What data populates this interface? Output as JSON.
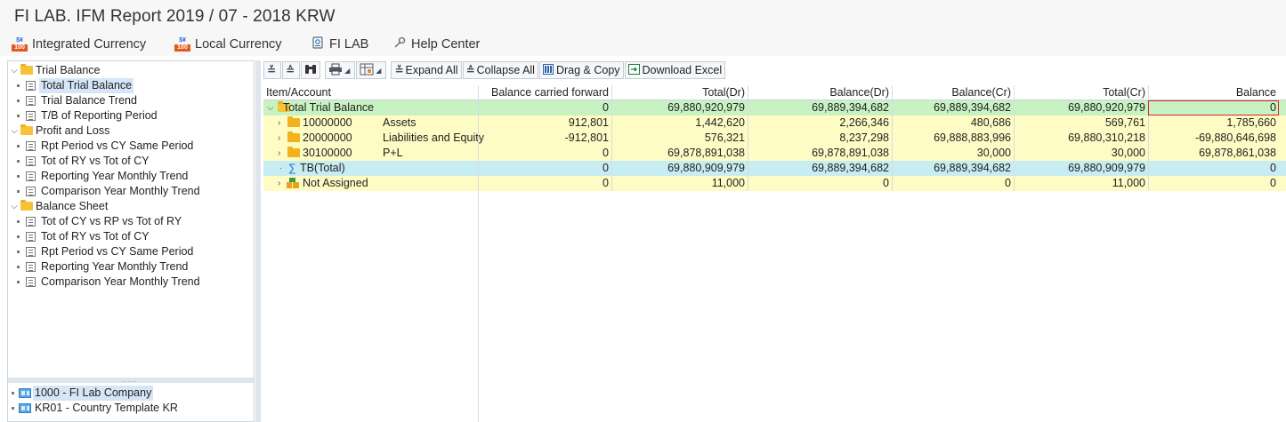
{
  "window": {
    "title": "FI LAB. IFM Report 2019 / 07 - 2018 KRW"
  },
  "menu": [
    {
      "label": "Integrated Currency",
      "icon": "currency-icon"
    },
    {
      "label": "Local Currency",
      "icon": "currency-icon"
    },
    {
      "label": "FI LAB",
      "icon": "fi-lab-icon"
    },
    {
      "label": "Help Center",
      "icon": "help-icon"
    }
  ],
  "nav_tree": {
    "groups": [
      {
        "label": "Trial Balance",
        "expanded": true,
        "items": [
          "Total Trial Balance",
          "Trial Balance Trend",
          "T/B of Reporting Period"
        ]
      },
      {
        "label": "Profit and Loss",
        "expanded": true,
        "items": [
          "Rpt Period vs CY Same Period",
          "Tot of RY vs Tot of CY",
          "Reporting Year Monthly Trend",
          "Comparison Year Monthly Trend"
        ]
      },
      {
        "label": "Balance Sheet",
        "expanded": true,
        "items": [
          "Tot of CY vs RP vs Tot of RY",
          "Tot of RY vs Tot of CY",
          "Rpt Period vs CY Same Period",
          "Reporting Year Monthly Trend",
          "Comparison Year Monthly Trend"
        ]
      }
    ],
    "selected": "Total Trial Balance"
  },
  "companies": [
    {
      "label": "1000 - FI Lab Company",
      "selected": true
    },
    {
      "label": "KR01 - Country Template KR",
      "selected": false
    }
  ],
  "toolbar": {
    "expand_all": "Expand All",
    "collapse_all": "Collapse All",
    "drag_copy": "Drag & Copy",
    "download_excel": "Download Excel"
  },
  "table": {
    "columns": [
      "Item/Account",
      "Balance carried forward",
      "Total(Dr)",
      "Balance(Dr)",
      "Balance(Cr)",
      "Total(Cr)",
      "Balance"
    ],
    "rows": [
      {
        "account": "Total Trial Balance",
        "desc": "",
        "style": "green",
        "level": 0,
        "expanded": true,
        "icon": "folder-open-icon",
        "values": [
          "0",
          "69,880,920,979",
          "69,889,394,682",
          "69,889,394,682",
          "69,880,920,979",
          "0"
        ]
      },
      {
        "account": "10000000",
        "desc": "Assets",
        "style": "yellow",
        "level": 1,
        "expanded": false,
        "icon": "folder-icon",
        "values": [
          "912,801",
          "1,442,620",
          "2,266,346",
          "480,686",
          "569,761",
          "1,785,660"
        ]
      },
      {
        "account": "20000000",
        "desc": "Liabilities and Equity",
        "style": "yellow",
        "level": 1,
        "expanded": false,
        "icon": "folder-icon",
        "values": [
          "-912,801",
          "576,321",
          "8,237,298",
          "69,888,883,996",
          "69,880,310,218",
          "-69,880,646,698"
        ]
      },
      {
        "account": "30100000",
        "desc": "P+L",
        "style": "yellow",
        "level": 1,
        "expanded": false,
        "icon": "folder-icon",
        "values": [
          "0",
          "69,878,891,038",
          "69,878,891,038",
          "30,000",
          "30,000",
          "69,878,861,038"
        ]
      },
      {
        "account": "TB(Total)",
        "desc": "",
        "style": "cyan",
        "level": 1,
        "expanded": null,
        "icon": "sigma-icon",
        "values": [
          "0",
          "69,880,909,979",
          "69,889,394,682",
          "69,889,394,682",
          "69,880,909,979",
          "0"
        ]
      },
      {
        "account": "Not Assigned",
        "desc": "",
        "style": "yellow",
        "level": 1,
        "expanded": false,
        "icon": "not-assigned-icon",
        "values": [
          "0",
          "11,000",
          "0",
          "0",
          "11,000",
          "0"
        ]
      }
    ]
  },
  "colors": {
    "green_row": "#c9f2c2",
    "yellow_row": "#fefcc4",
    "cyan_row": "#c7ecf2",
    "selection": "#d6e6f8"
  }
}
